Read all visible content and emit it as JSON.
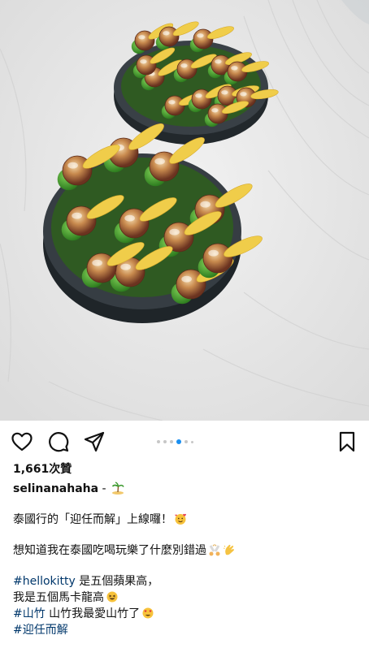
{
  "post": {
    "likes": "1,661次贊",
    "username": "selinanahaha",
    "user_suffix": " - ",
    "carousel": {
      "count": 6,
      "active_index": 3
    },
    "caption": [
      {
        "text": "泰國行的「迎任而解」上線囉！",
        "emoji": "smiling-face-hearts-icon"
      },
      {
        "text": "想知道我在泰國吃喝玩樂了什麼別錯過",
        "emoji": "cheering-icon"
      },
      {
        "tag": "#hellokitty",
        "text": " 是五個蘋果高，"
      },
      {
        "text": "我是五個馬卡龍高",
        "emoji": "grinning-icon"
      },
      {
        "tag": "#山竹",
        "text": " 山竹我最愛山竹了",
        "emoji": "heart-eyes-icon"
      },
      {
        "tag": "#迎任而解"
      }
    ]
  },
  "icons": {
    "like": "heart-icon",
    "comment": "comment-icon",
    "share": "share-icon",
    "save": "bookmark-icon",
    "island": "island-icon"
  },
  "colors": {
    "hashtag": "#00376b",
    "active_dot": "#1a8ff0",
    "inactive_dot": "#c7c7c7",
    "plate": "#ececec",
    "tart_base": "#2b3136",
    "pea_green": "#3f9a2c",
    "petal_yellow": "#f0cd4a",
    "gel_amber": "#b5703d"
  }
}
